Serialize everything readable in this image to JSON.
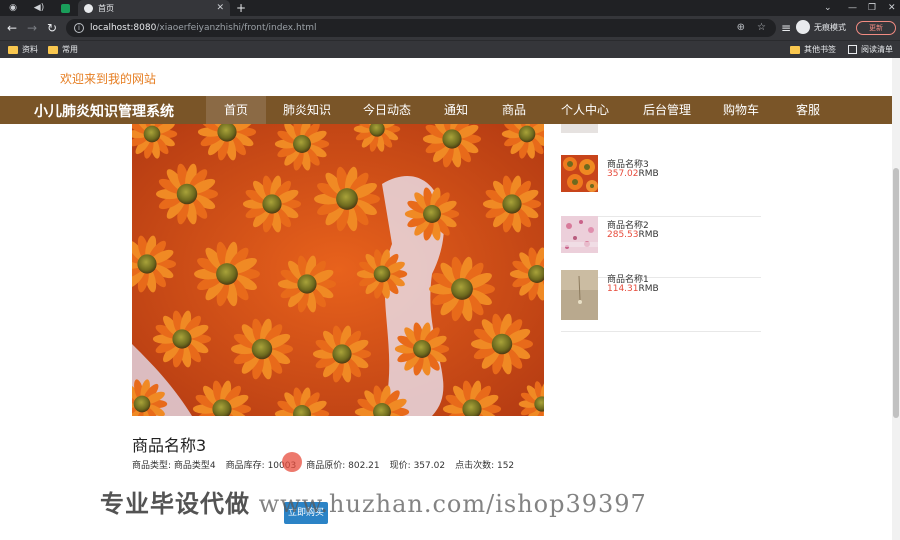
{
  "browser": {
    "tab_title": "首页",
    "url_host": "localhost:8080",
    "url_path": "/xiaoerfeiyanzhishi/front/index.html",
    "incognito_label": "无痕模式",
    "update_label": "更新",
    "bookmarks": [
      "资料",
      "常用"
    ],
    "other_bookmarks": "其他书签",
    "reading_list": "阅读清单"
  },
  "page": {
    "welcome": "欢迎来到我的网站",
    "site_title": "小儿肺炎知识管理系统",
    "nav": [
      "首页",
      "肺炎知识",
      "今日动态",
      "通知",
      "商品",
      "个人中心",
      "后台管理",
      "购物车",
      "客服"
    ],
    "product": {
      "title": "商品名称3",
      "type_label": "商品类型:",
      "type_value": "商品类型4",
      "stock_label": "商品库存:",
      "stock_value": "10003",
      "orig_price_label": "商品原价:",
      "orig_price_value": "802.21",
      "price_label": "现价:",
      "price_value": "357.02",
      "clicks_label": "点击次数:",
      "clicks_value": "152",
      "buy_label": "立即购买"
    },
    "sidebar": [
      {
        "name": "商品名称3",
        "price": "357.02",
        "unit": "RMB"
      },
      {
        "name": "商品名称2",
        "price": "285.53",
        "unit": "RMB"
      },
      {
        "name": "商品名称1",
        "price": "114.31",
        "unit": "RMB"
      }
    ],
    "watermark_cn": "专业毕设代做",
    "watermark_url": "www.huzhan.com/ishop39397"
  },
  "colors": {
    "nav_bg": "#7a5528",
    "welcome": "#e67e22",
    "price": "#e74c3c",
    "buy_button": "#2b83c6"
  }
}
